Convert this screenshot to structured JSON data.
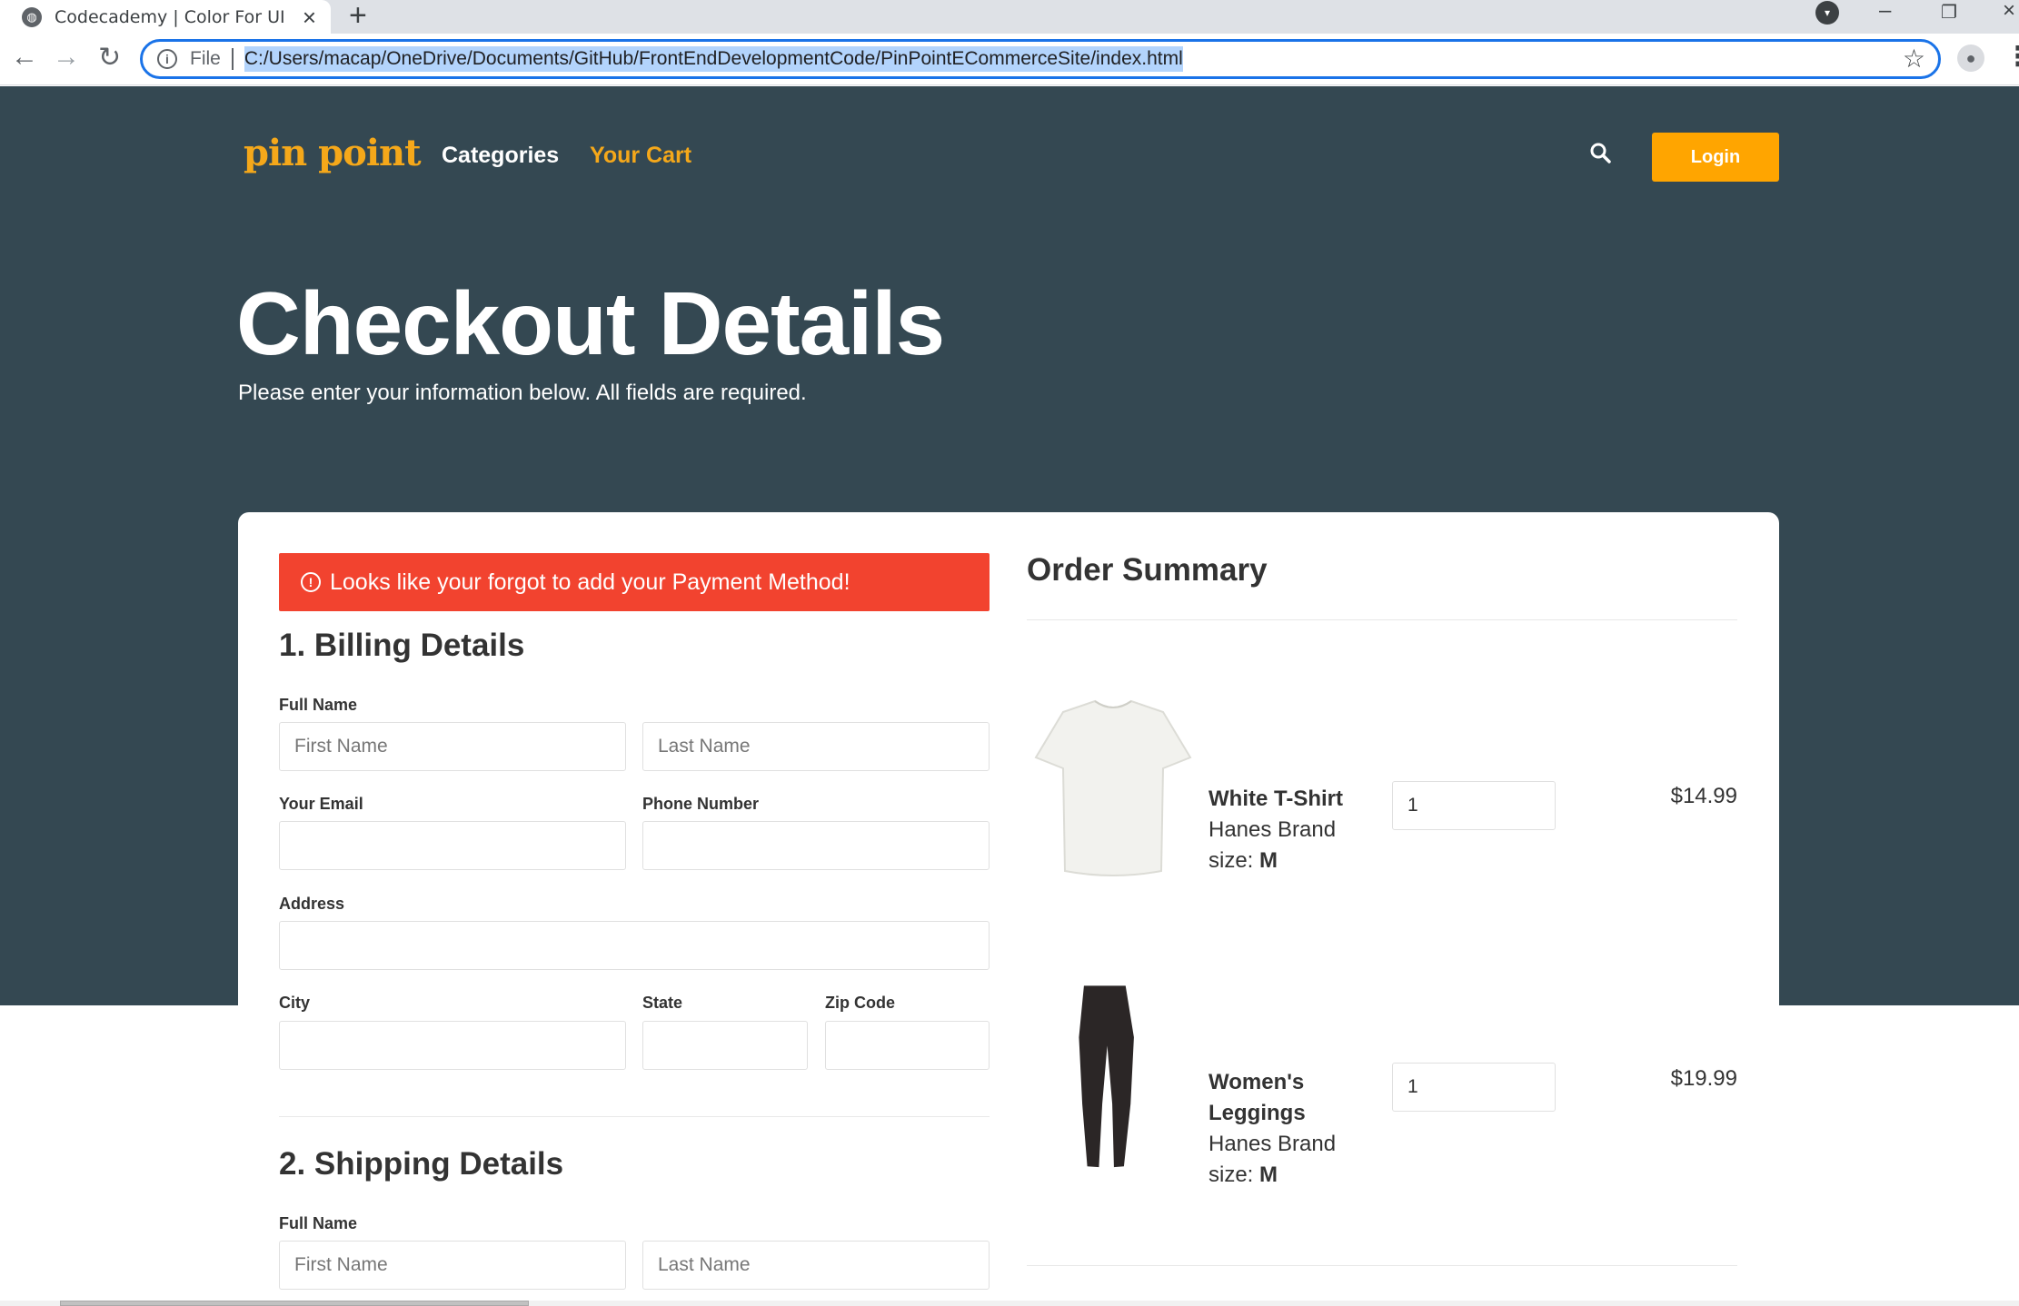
{
  "browser": {
    "tab_title": "Codecademy | Color For UI",
    "file_label": "File",
    "url": "C:/Users/macap/OneDrive/Documents/GitHub/FrontEndDevelopmentCode/PinPointECommerceSite/index.html"
  },
  "header": {
    "logo": "pin point",
    "nav": [
      "Categories",
      "Your Cart"
    ],
    "login_label": "Login"
  },
  "hero": {
    "title": "Checkout Details",
    "subtitle": "Please enter your information below. All fields are required."
  },
  "alert": {
    "message": "Looks like your forgot to add your Payment Method!"
  },
  "billing": {
    "title": "1. Billing Details",
    "full_name_label": "Full Name",
    "first_name_placeholder": "First Name",
    "last_name_placeholder": "Last Name",
    "email_label": "Your Email",
    "phone_label": "Phone Number",
    "address_label": "Address",
    "city_label": "City",
    "state_label": "State",
    "zip_label": "Zip Code"
  },
  "shipping": {
    "title": "2. Shipping Details",
    "full_name_label": "Full Name",
    "first_name_placeholder": "First Name",
    "last_name_placeholder": "Last Name"
  },
  "summary": {
    "title": "Order Summary",
    "items": [
      {
        "name": "White T-Shirt",
        "brand": "Hanes Brand",
        "size_prefix": "size:",
        "size": "M",
        "qty": "1",
        "price": "$14.99"
      },
      {
        "name": "Women's Leggings",
        "brand": "Hanes Brand",
        "size_prefix": "size:",
        "size": "M",
        "qty": "1",
        "price": "$19.99"
      }
    ]
  },
  "colors": {
    "hero_bg": "#344852",
    "accent": "#ffa500",
    "alert": "#f2432f",
    "logo": "#f5a81a"
  }
}
